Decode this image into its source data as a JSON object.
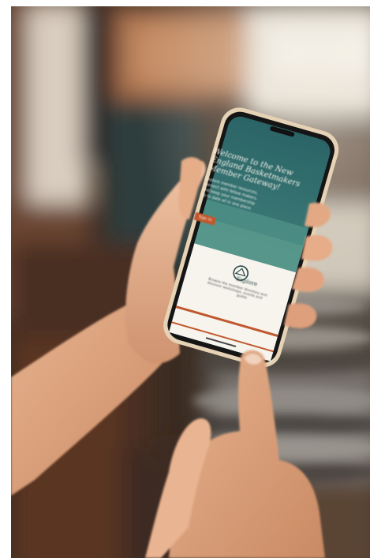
{
  "scene": {
    "description_none": "",
    "phone_screen": {
      "heading_lines": [
        "Welcome to the New",
        "England Basketmakers",
        "Member Gateway!"
      ],
      "body_lines": [
        "Explore member resources,",
        "connect with fellow makers,",
        "and keep your membership",
        "up to date all in one place."
      ],
      "cta_label": "Sign In",
      "card_title": "Explore",
      "card_lines": [
        "Browse the member directory and",
        "discover workshops, events and",
        "guilds"
      ]
    },
    "colors": {
      "screen_teal": "#2f6b6b",
      "accent_orange": "#c0582e",
      "phone_case": "#e8d4b8"
    }
  }
}
